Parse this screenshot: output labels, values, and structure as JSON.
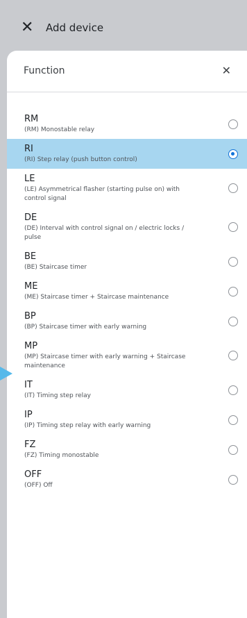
{
  "header": {
    "close_icon": "close-icon",
    "title": "Add device"
  },
  "sheet": {
    "title": "Function",
    "close_icon": "close-icon"
  },
  "options": [
    {
      "code": "RM",
      "desc": "(RM) Monostable relay",
      "selected": false
    },
    {
      "code": "RI",
      "desc": "(RI) Step relay (push button control)",
      "selected": true
    },
    {
      "code": "LE",
      "desc": "(LE) Asymmetrical flasher (starting pulse on) with control signal",
      "selected": false
    },
    {
      "code": "DE",
      "desc": "(DE) Interval with control signal on / electric locks / pulse",
      "selected": false
    },
    {
      "code": "BE",
      "desc": "(BE) Staircase timer",
      "selected": false
    },
    {
      "code": "ME",
      "desc": "(ME) Staircase timer + Staircase maintenance",
      "selected": false
    },
    {
      "code": "BP",
      "desc": "(BP) Staircase timer with early warning",
      "selected": false
    },
    {
      "code": "MP",
      "desc": "(MP) Staircase timer with early warning + Staircase maintenance",
      "selected": false
    },
    {
      "code": "IT",
      "desc": "(IT) Timing step relay",
      "selected": false
    },
    {
      "code": "IP",
      "desc": "(IP) Timing step relay with early warning",
      "selected": false
    },
    {
      "code": "FZ",
      "desc": "(FZ) Timing monostable",
      "selected": false
    },
    {
      "code": "OFF",
      "desc": "(OFF) Off",
      "selected": false
    }
  ],
  "colors": {
    "selected_row": "#a7d6f0",
    "radio_selected": "#1273d8",
    "backdrop": "#c9cbcf",
    "pointer_arrow": "#56b9ea"
  }
}
